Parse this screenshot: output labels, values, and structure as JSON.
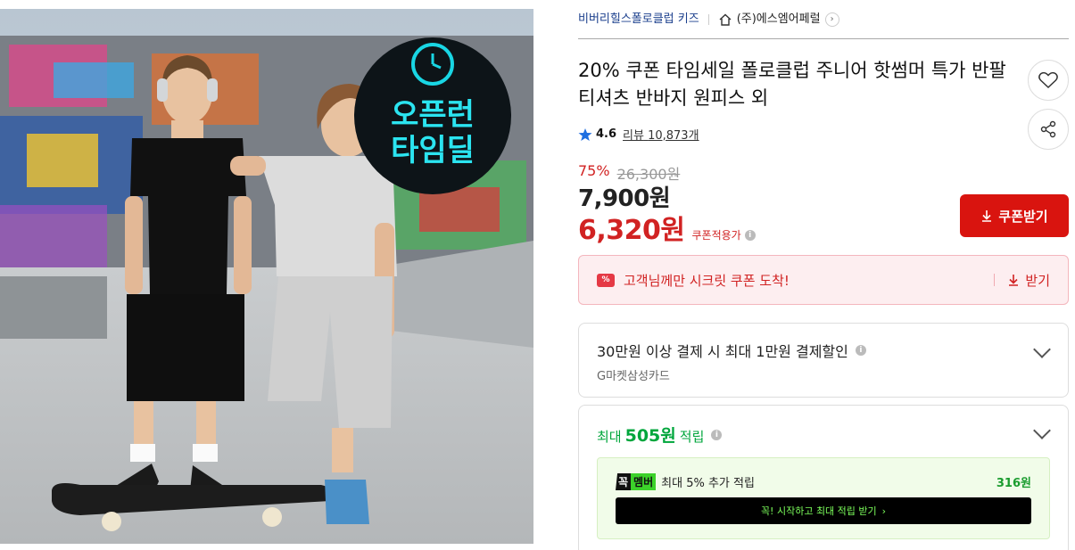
{
  "image": {
    "badge_line1": "오픈런",
    "badge_line2": "타임딜"
  },
  "breadcrumb": {
    "brand": "비버리힐스폴로클럽 키즈",
    "seller": "(주)에스엠어페럴",
    "home_icon": "home-icon",
    "chevron": "›"
  },
  "product": {
    "title": "20% 쿠폰 타임세일 폴로클럽 주니어 핫썸머 특가 반팔티셔츠 반바지 원피스 외",
    "rating": "4.6",
    "review_label": "리뷰",
    "review_count": "10,873개"
  },
  "price": {
    "discount_rate": "75%",
    "original": "26,300원",
    "sale": "7,900원",
    "coupon_price": "6,320원",
    "coupon_note": "쿠폰적용가",
    "coupon_button": "쿠폰받기"
  },
  "secret_coupon": {
    "icon_text": "%",
    "text": "고객님께만 시크릿 쿠폰 도착!",
    "action": "받기"
  },
  "payment_discount": {
    "title": "30만원 이상 결제 시 최대 1만원 결제할인",
    "card": "G마켓삼성카드"
  },
  "points": {
    "prefix": "최대",
    "amount": "505원",
    "suffix": "적립",
    "member_badge_a": "꼭",
    "member_badge_b": "멤버",
    "member_text": "최대 5% 추가 적립",
    "member_amount": "316원",
    "start_button": "꼭! 시작하고 최대 적립 받기",
    "start_chevron": "›"
  },
  "colors": {
    "accent_red": "#d9140f",
    "brand_blue": "#1a3e8c",
    "points_green": "#00a63c"
  }
}
